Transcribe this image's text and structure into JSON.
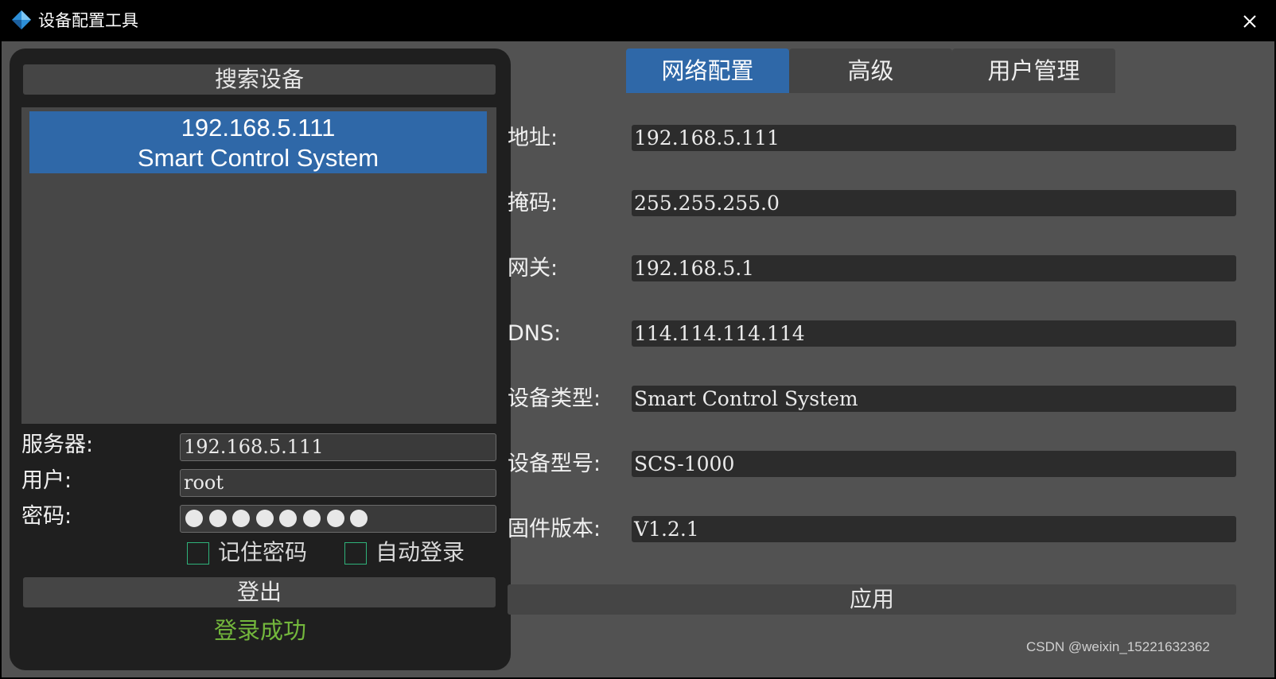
{
  "window": {
    "title": "设备配置工具",
    "icon": "app-diamond-icon",
    "close_icon": "close-icon"
  },
  "left_panel": {
    "search_button": "搜索设备",
    "devices": [
      {
        "ip": "192.168.5.111",
        "name": "Smart Control System",
        "selected": true
      }
    ],
    "server_label": "服务器:",
    "server_value": "192.168.5.111",
    "user_label": "用户:",
    "user_value": "root",
    "password_label": "密码:",
    "password_mask_count": 8,
    "remember_password": {
      "label": "记住密码",
      "checked": false
    },
    "auto_login": {
      "label": "自动登录",
      "checked": false
    },
    "logout_button": "登出",
    "status": "登录成功"
  },
  "tabs": [
    {
      "label": "网络配置",
      "active": true
    },
    {
      "label": "高级",
      "active": false
    },
    {
      "label": "用户管理",
      "active": false
    }
  ],
  "network": {
    "fields": [
      {
        "label": "地址:",
        "value": "192.168.5.111"
      },
      {
        "label": "掩码:",
        "value": "255.255.255.0"
      },
      {
        "label": "网关:",
        "value": "192.168.5.1"
      },
      {
        "label": "DNS:",
        "value": "114.114.114.114"
      },
      {
        "label": "设备类型:",
        "value": "Smart Control System"
      },
      {
        "label": "设备型号:",
        "value": "SCS-1000"
      },
      {
        "label": "固件版本:",
        "value": "V1.2.1"
      }
    ],
    "apply_button": "应用"
  },
  "watermark": "CSDN @weixin_15221632362",
  "colors": {
    "accent": "#2f68a8",
    "success": "#73b73c",
    "checkbox_border": "#2fb27a",
    "background": "#525252",
    "panel": "#1f1f1f"
  }
}
